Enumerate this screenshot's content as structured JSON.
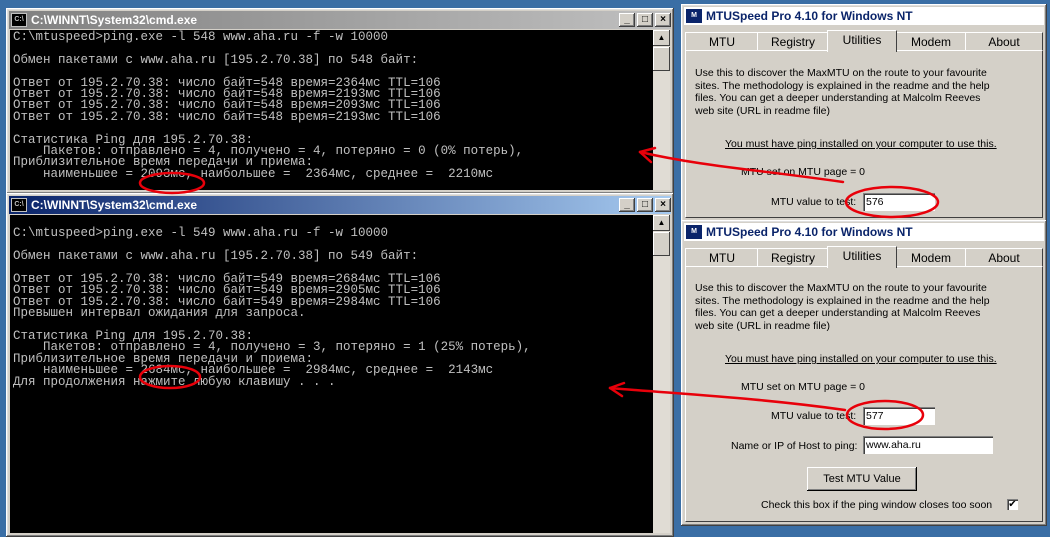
{
  "cmd1": {
    "title": "C:\\WINNT\\System32\\cmd.exe",
    "lines": [
      "C:\\mtuspeed>ping.exe -l 548 www.aha.ru -f -w 10000",
      "",
      "Обмен пакетами с www.aha.ru [195.2.70.38] по 548 байт:",
      "",
      "Ответ от 195.2.70.38: число байт=548 время=2364мс TTL=106",
      "Ответ от 195.2.70.38: число байт=548 время=2193мс TTL=106",
      "Ответ от 195.2.70.38: число байт=548 время=2093мс TTL=106",
      "Ответ от 195.2.70.38: число байт=548 время=2193мс TTL=106",
      "",
      "Статистика Ping для 195.2.70.38:",
      "    Пакетов: отправлено = 4, получено = 4, потеряно = 0 (0% потерь),",
      "Приблизительное время передачи и приема:",
      "    наименьшее = 2093мс, наибольшее =  2364мс, среднее =  2210мс"
    ]
  },
  "cmd2": {
    "title": "C:\\WINNT\\System32\\cmd.exe",
    "lines": [
      "",
      "C:\\mtuspeed>ping.exe -l 549 www.aha.ru -f -w 10000",
      "",
      "Обмен пакетами с www.aha.ru [195.2.70.38] по 549 байт:",
      "",
      "Ответ от 195.2.70.38: число байт=549 время=2684мс TTL=106",
      "Ответ от 195.2.70.38: число байт=549 время=2905мс TTL=106",
      "Ответ от 195.2.70.38: число байт=549 время=2984мс TTL=106",
      "Превышен интервал ожидания для запроса.",
      "",
      "Статистика Ping для 195.2.70.38:",
      "    Пакетов: отправлено = 4, получено = 3, потеряно = 1 (25% потерь),",
      "Приблизительное время передачи и приема:",
      "    наименьшее = 2684мс, наибольшее =  2984мс, среднее =  2143мс",
      "Для продолжения нажмите любую клавишу . . ."
    ]
  },
  "mtu1": {
    "title": "MTUSpeed Pro 4.10 for Windows NT",
    "tabs": [
      "MTU",
      "Registry",
      "Utilities",
      "Modem",
      "About"
    ],
    "desc": [
      "Use this to discover the MaxMTU on the route to your favourite",
      "sites. The methodology is explained in the readme and the help",
      "files. You can get a deeper understanding at Malcolm Reeves",
      "web site (URL in readme file)"
    ],
    "ping_note": "You must have ping installed on your computer to use this.",
    "mtu_set_label": "MTU set on MTU page = 0",
    "mtu_test_label": "MTU value to test:",
    "mtu_test_value": "576"
  },
  "mtu2": {
    "title": "MTUSpeed Pro 4.10 for Windows NT",
    "tabs": [
      "MTU",
      "Registry",
      "Utilities",
      "Modem",
      "About"
    ],
    "desc": [
      "Use this to discover the MaxMTU on the route to your favourite",
      "sites. The methodology is explained in the readme and the help",
      "files. You can get a deeper understanding at Malcolm Reeves",
      "web site (URL in readme file)"
    ],
    "ping_note": "You must have ping installed on your computer to use this.",
    "mtu_set_label": "MTU set on MTU page = 0",
    "mtu_test_label": "MTU value to test:",
    "mtu_test_value": "577",
    "host_label": "Name or IP of Host to ping:",
    "host_value": "www.aha.ru",
    "test_button": "Test MTU Value",
    "check_label": "Check this box if the ping window closes too soon",
    "check_mark": "✔"
  },
  "colors": {
    "annotation": "#e8000a",
    "title_active": "#0a246a",
    "console_text": "#c0c0c0"
  }
}
